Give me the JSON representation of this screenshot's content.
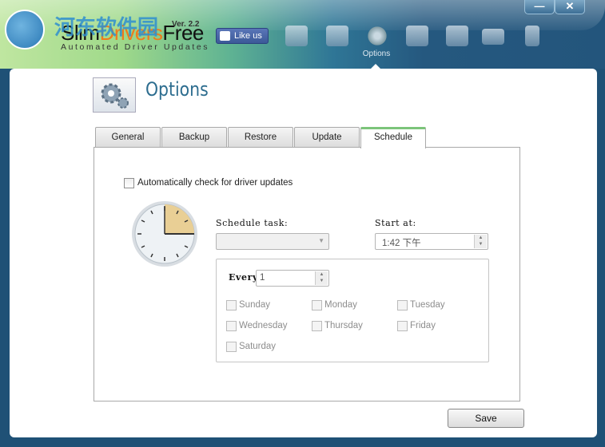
{
  "app": {
    "watermark": "河东软件园",
    "brand_slim": "Slim",
    "brand_drivers": "Drivers",
    "brand_free": "Free",
    "version": "Ver. 2.2",
    "tagline": "Automated Driver Updates",
    "like_us": "Like us"
  },
  "nav": {
    "items": [
      {
        "icon": "home-icon"
      },
      {
        "icon": "scan-icon"
      },
      {
        "icon": "gear-icon",
        "label": "Options"
      },
      {
        "icon": "restore-icon"
      },
      {
        "icon": "add-driver-icon"
      },
      {
        "icon": "hardware-icon"
      },
      {
        "icon": "user-icon"
      }
    ]
  },
  "window": {
    "minimize": "—",
    "close": "✕"
  },
  "page": {
    "title": "Options"
  },
  "tabs": [
    {
      "label": "General"
    },
    {
      "label": "Backup"
    },
    {
      "label": "Restore"
    },
    {
      "label": "Update"
    },
    {
      "label": "Schedule",
      "active": true
    }
  ],
  "schedule": {
    "auto_check_label": "Automatically check for driver updates",
    "auto_check": false,
    "task_label": "Schedule task:",
    "task_value": "",
    "start_label": "Start at:",
    "start_value": "1:42 下午",
    "every_label": "Every",
    "every_value": "1",
    "days": [
      {
        "label": "Sunday"
      },
      {
        "label": "Monday"
      },
      {
        "label": "Tuesday"
      },
      {
        "label": "Wednesday"
      },
      {
        "label": "Thursday"
      },
      {
        "label": "Friday"
      },
      {
        "label": "Saturday"
      }
    ]
  },
  "footer": {
    "save": "Save"
  },
  "colors": {
    "accent": "#2d6d8f",
    "active_tab": "#7cc47a"
  }
}
